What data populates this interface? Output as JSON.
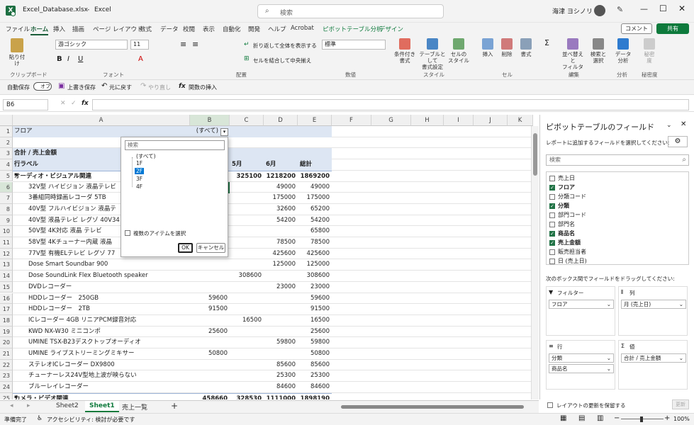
{
  "title_bar": {
    "filename": "Excel_Database.xlsx",
    "sep": "-",
    "app": "Excel",
    "search": "検索",
    "user": "海津 ヨシノリ"
  },
  "menu": [
    "ファイル",
    "ホーム",
    "挿入",
    "描画",
    "ページ レイアウト",
    "数式",
    "データ",
    "校閲",
    "表示",
    "自動化",
    "開発",
    "ヘルプ",
    "Acrobat",
    "ピボットテーブル分析",
    "デザイン"
  ],
  "comment_btn": "コメント",
  "share_btn": "共有",
  "ribbon": {
    "paste": "貼り付け",
    "font_name": "游ゴシック",
    "font_size": "11",
    "wrap": "折り返して全体を表示する",
    "merge": "セルを結合して中央揃え",
    "number_format": "標準",
    "cond": "条件付き\n書式",
    "table": "テーブルとして\n書式設定",
    "style": "セルの\nスタイル",
    "insert": "挿入",
    "delete": "削除",
    "format": "書式",
    "sort": "並べ替えと\nフィルター",
    "find": "検索と\n選択",
    "analyze": "データ\n分析",
    "sensitivity": "秘密\n度",
    "groups": [
      "クリップボード",
      "フォント",
      "配置",
      "数値",
      "スタイル",
      "セル",
      "編集",
      "分析",
      "秘密度"
    ]
  },
  "qat": {
    "autosave": "自動保存",
    "autosave_state": "オフ",
    "save": "上書き保存",
    "undo": "元に戻す",
    "redo": "やり直し",
    "insert_fn": "関数の挿入"
  },
  "formula_bar": {
    "name_box": "B6",
    "fx": "fx"
  },
  "columns": [
    "A",
    "B",
    "C",
    "D",
    "E",
    "F",
    "G",
    "H",
    "I",
    "J",
    "K"
  ],
  "rows": [
    {
      "n": "1",
      "a": "フロア",
      "b": "(すべて)"
    },
    {
      "n": "2"
    },
    {
      "n": "3",
      "a": "合計 / 売上金額"
    },
    {
      "n": "4",
      "a": "行ラベル",
      "c": "5月",
      "d": "6月",
      "e": "総計"
    },
    {
      "n": "5",
      "a": "オーディオ・ビジュアル関連",
      "c": "325100",
      "d": "1218200",
      "e": "1869200"
    },
    {
      "n": "6",
      "a": "32V型 ハイビジョン 液晶テレビ",
      "d": "49000",
      "e": "49000"
    },
    {
      "n": "7",
      "a": "3番組同時録画レコーダ 5TB",
      "d": "175000",
      "e": "175000"
    },
    {
      "n": "8",
      "a": "40V型 フルハイビジョン 液晶テ",
      "d": "32600",
      "e": "65200"
    },
    {
      "n": "9",
      "a": "40V型 液晶テレビ レグゾ 40V34",
      "d": "54200",
      "e": "54200"
    },
    {
      "n": "10",
      "a": "50V型 4K対応 液晶 テレビ",
      "e": "65800"
    },
    {
      "n": "11",
      "a": "58V型 4Kチューナー内蔵 液晶",
      "d": "78500",
      "e": "78500"
    },
    {
      "n": "12",
      "a": "77V型 有機ELテレビ レグゾ 77",
      "d": "425600",
      "e": "425600"
    },
    {
      "n": "13",
      "a": "Dose Smart Soundbar 900",
      "d": "125000",
      "e": "125000"
    },
    {
      "n": "14",
      "a": "Dose SoundLink Flex Bluetooth speaker",
      "c": "308600",
      "e": "308600"
    },
    {
      "n": "15",
      "a": "DVDレコーダー",
      "d": "23000",
      "e": "23000"
    },
    {
      "n": "16",
      "a": "HDDレコーダー　250GB",
      "b": "59600",
      "e": "59600"
    },
    {
      "n": "17",
      "a": "HDDレコーダー　2TB",
      "b": "91500",
      "e": "91500"
    },
    {
      "n": "18",
      "a": "ICレコーダー 4GB リニアPCM録音対応",
      "c": "16500",
      "e": "16500"
    },
    {
      "n": "19",
      "a": "KWD NX-W30 ミニコンポ",
      "b": "25600",
      "e": "25600"
    },
    {
      "n": "20",
      "a": "UMINE TSX-B23デスクトップオーディオ",
      "d": "59800",
      "e": "59800"
    },
    {
      "n": "21",
      "a": "UMINE ライブストリーミングミキサー",
      "b": "50800",
      "e": "50800"
    },
    {
      "n": "22",
      "a": "ステレオICレコーダー DX9800",
      "d": "85600",
      "e": "85600"
    },
    {
      "n": "23",
      "a": "チューナーレス24V型地上波が映らない",
      "d": "25300",
      "e": "25300"
    },
    {
      "n": "24",
      "a": "ブルーレイレコーダー",
      "d": "84600",
      "e": "84600"
    },
    {
      "n": "25",
      "a": "カメラ・ビデオ関連",
      "b": "458660",
      "c": "328530",
      "d": "1111000",
      "e": "1898190"
    }
  ],
  "dropdown": {
    "search": "検索",
    "items": [
      "(すべて)",
      "1F",
      "2F",
      "3F",
      "4F"
    ],
    "multi": "複数のアイテムを選択",
    "ok": "OK",
    "cancel": "キャンセル"
  },
  "sheets": [
    "Sheet2",
    "Sheet1",
    "売上一覧"
  ],
  "pane": {
    "title": "ピボットテーブルのフィールド",
    "subtitle": "レポートに追加するフィールドを選択してください:",
    "search": "検索",
    "fields": [
      {
        "name": "売上日",
        "on": false
      },
      {
        "name": "フロア",
        "on": true
      },
      {
        "name": "分類コード",
        "on": false
      },
      {
        "name": "分類",
        "on": true
      },
      {
        "name": "部門コード",
        "on": false
      },
      {
        "name": "部門名",
        "on": false
      },
      {
        "name": "商品名",
        "on": true
      },
      {
        "name": "売上金額",
        "on": true
      },
      {
        "name": "販売担当者",
        "on": false
      },
      {
        "name": "日 (売上日)",
        "on": false
      }
    ],
    "drag_hint": "次のボックス間でフィールドをドラッグしてください:",
    "filter_label": "フィルター",
    "col_label": "列",
    "row_label": "行",
    "val_label": "値",
    "filter_item": "フロア",
    "col_item": "月 (売上日)",
    "row_items": [
      "分類",
      "商品名"
    ],
    "val_item": "合計 / 売上金額",
    "defer": "レイアウトの更新を保留する",
    "update": "更新"
  },
  "status": {
    "ready": "準備完了",
    "access": "アクセシビリティ: 検討が必要です",
    "zoom": "100%"
  }
}
